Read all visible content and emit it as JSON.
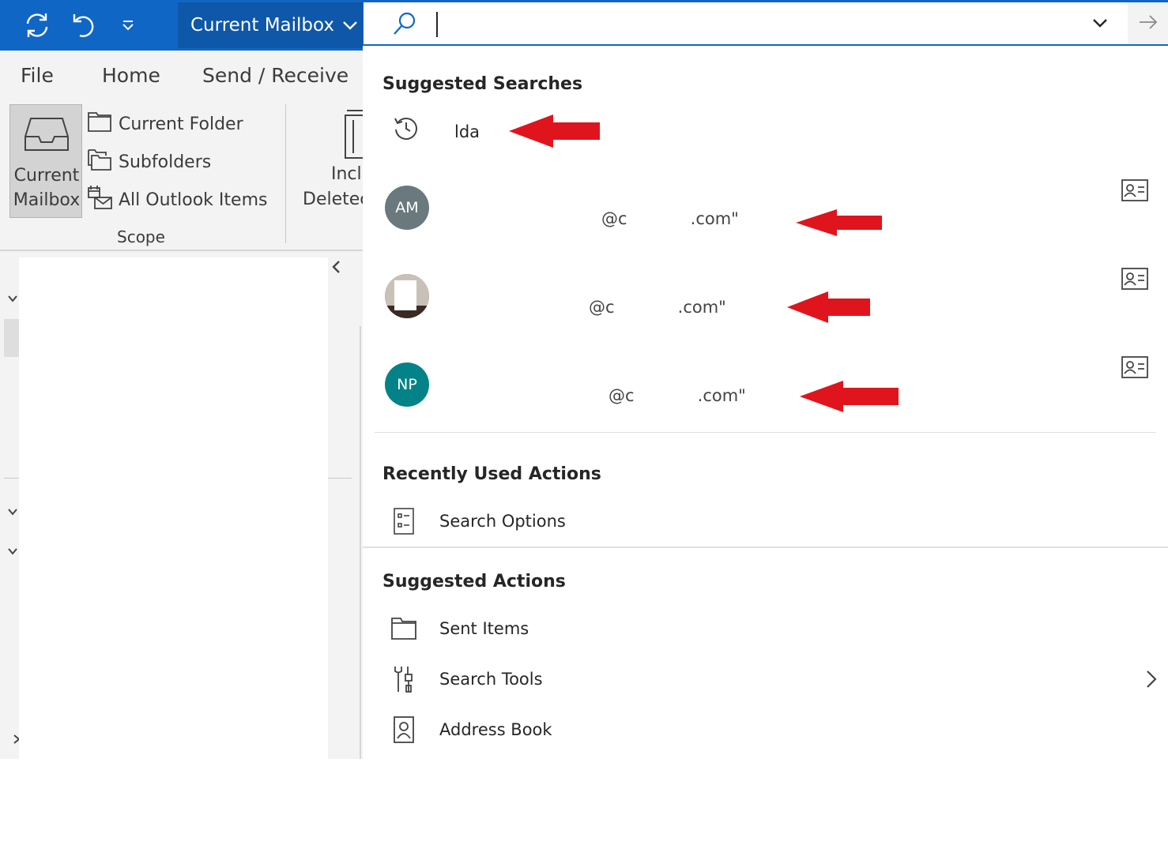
{
  "titlebar": {
    "scope_dropdown_label": "Current Mailbox",
    "accent_color": "#1066c5"
  },
  "search": {
    "placeholder": "",
    "value": ""
  },
  "ribbon": {
    "tabs": [
      "File",
      "Home",
      "Send / Receive"
    ],
    "scope_group": {
      "big_button_line1": "Current",
      "big_button_line2": "Mailbox",
      "options": [
        "Current Folder",
        "Subfolders",
        "All Outlook Items"
      ],
      "label": "Scope"
    },
    "delete_button_line1": "Inclu",
    "delete_button_line2": "Deletec"
  },
  "panel": {
    "suggested_searches_title": "Suggested Searches",
    "recent_query": "lda",
    "contacts": [
      {
        "initials": "AM",
        "color": "#69797e",
        "email_display": "@c            .com\""
      },
      {
        "initials": "",
        "color": "#8a7f78",
        "email_display": "@c            .com\""
      },
      {
        "initials": "NP",
        "color": "#038387",
        "email_display": "@c            .com\""
      }
    ],
    "recently_used_title": "Recently Used Actions",
    "recent_actions": [
      {
        "label": "Search Options",
        "icon": "search-options-icon"
      }
    ],
    "suggested_actions_title": "Suggested Actions",
    "suggested_actions": [
      {
        "label": "Sent Items",
        "icon": "folder-icon"
      },
      {
        "label": "Search Tools",
        "icon": "tools-icon"
      },
      {
        "label": "Address Book",
        "icon": "address-book-icon"
      }
    ],
    "annotation_arrow_color": "#e0141c"
  }
}
